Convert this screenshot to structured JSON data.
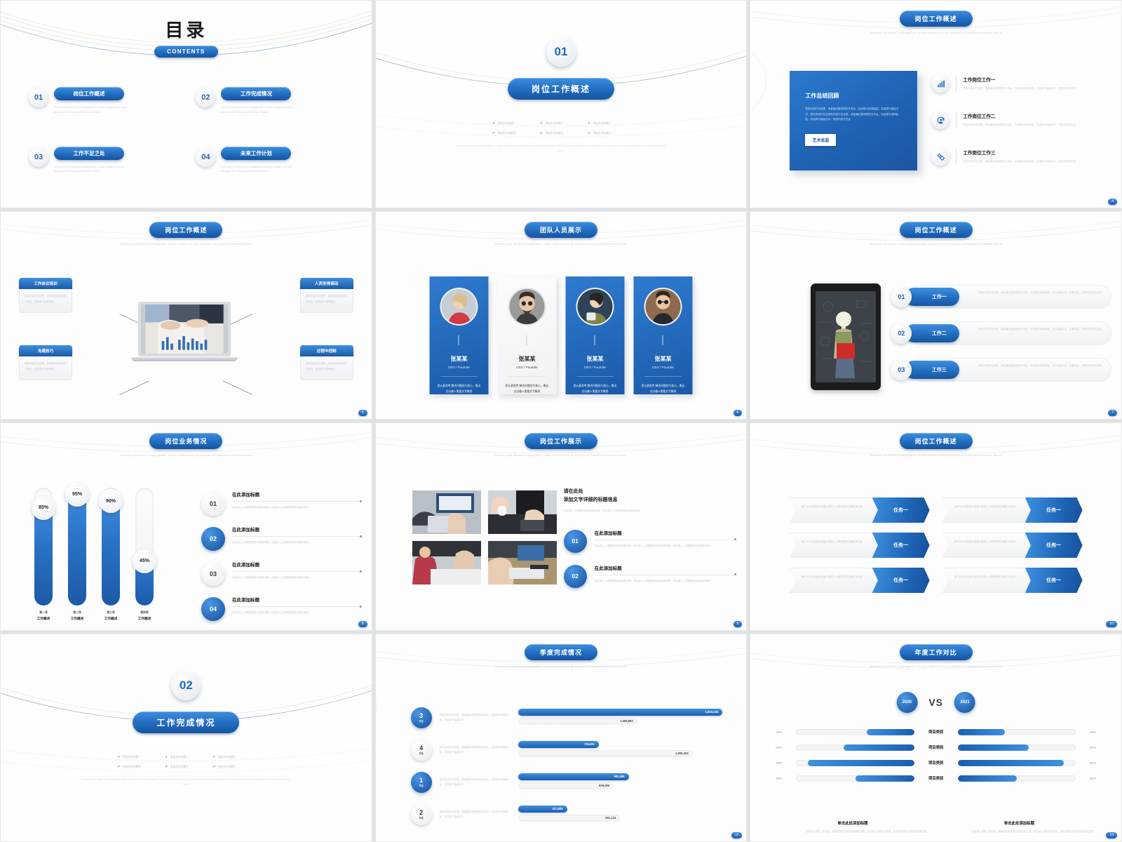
{
  "deck": {
    "theme_accent": "#1f66b8",
    "theme_accent_light": "#3f90e0"
  },
  "slides": [
    {
      "page": "",
      "kind": "contents",
      "title": "目录",
      "contents_label": "CONTENTS",
      "items": [
        {
          "num": "01",
          "label": "岗位工作概述",
          "desc": "Summary and Report of management, simple creative work ppt template of Professional Business Report"
        },
        {
          "num": "02",
          "label": "工作完成情况",
          "desc": "Summary and Report of management, simple creative work ppt template of Professional Business Report"
        },
        {
          "num": "03",
          "label": "工作不足之处",
          "desc": "Summary and Report of management, simple creative work ppt template of Professional Business Report"
        },
        {
          "num": "04",
          "label": "未来工作计划",
          "desc": "Summary and Report of management, simple creative work ppt template of Professional Business Report"
        }
      ]
    },
    {
      "page": "",
      "kind": "section",
      "number": "01",
      "title": "岗位工作概述",
      "checks": [
        "添加文字标题一",
        "添加文字标题二",
        "添加文字标题三",
        "添加文字标题四",
        "添加文字标题五",
        "添加文字标题六"
      ],
      "footer": "Summary and Report of management, simple creative work ppt template of Professional Business Report. Summary and Report of management, simple creative work ppt template of Professional Business Report"
    },
    {
      "page": "4",
      "kind": "card-icons",
      "title": "岗位工作概述",
      "subtitle": "Summary and Report of management, simple creative work ppt template of Professional Business Report",
      "card": {
        "heading": "工作总结回顾",
        "body": "您的内容打在这里，或者通过复制您的文本后，在此框中选择粘贴，并选择只保留文字。您的内容打在这您的内容打在这里，或者通过复制您的文本后，在此框中选择粘贴，并选择只保留文字。您的内容打在这",
        "button": "艺术总监"
      },
      "rows": [
        {
          "icon": "bar-chart-icon",
          "heading": "工作岗位工作一",
          "body": "您的内容打在这里，或者通过复制您的文本后，在此框中选择粘贴，并选择只保留文字。您的内容打在这"
        },
        {
          "icon": "user-cycle-icon",
          "heading": "工作岗位工作二",
          "body": "您的内容打在这里，或者通过复制您的文本后，在此框中选择粘贴，并选择只保留文字。您的内容打在这"
        },
        {
          "icon": "gears-icon",
          "heading": "工作岗位工作三",
          "body": "您的内容打在这里，或者通过复制您的文本后，在此框中选择粘贴，并选择只保留文字。您的内容打在这"
        }
      ]
    },
    {
      "page": "5",
      "kind": "laptop-diagram",
      "title": "岗位工作概述",
      "subtitle": "Summary and Report of management, simple creative work ppt template of Professional Business Report",
      "boxes": [
        {
          "heading": "工作会议培训",
          "body": "您的内容打在这里，或者通过复制您的文本后，在此框中选择粘贴。"
        },
        {
          "heading": "人员安排调动",
          "body": "您的内容打在这里，或者通过复制您的文本后，在此框中选择粘贴。"
        },
        {
          "heading": "沟通技巧",
          "body": "您的内容打在这里，或者通过复制您的文本后，在此框中选择粘贴。"
        },
        {
          "heading": "过程中控制",
          "body": "您的内容打在这里，或者通过复制您的文本后，在此框中选择粘贴。"
        }
      ]
    },
    {
      "page": "6",
      "kind": "team",
      "title": "团队人员展示",
      "subtitle": "Summary and Report of management, simple creative work ppt template of Professional Business Report",
      "members": [
        {
          "name": "张某某",
          "role": "CEO / Founder",
          "bio": "您认真思考 解决问题技巧核心，概念点击输入需要文字解说",
          "style": "dark"
        },
        {
          "name": "张某某",
          "role": "CEO / Founder",
          "bio": "您认真思考 解决问题技巧核心，概念点击输入需要文字解说",
          "style": "light"
        },
        {
          "name": "张某某",
          "role": "CEO / Founder",
          "bio": "您认真思考 解决问题技巧核心，概念点击输入需要文字解说",
          "style": "dark"
        },
        {
          "name": "张某某",
          "role": "CEO / Founder",
          "bio": "您认真思考 解决问题技巧核心，概念点击输入需要文字解说",
          "style": "dark"
        }
      ]
    },
    {
      "page": "7",
      "kind": "tablet-steps",
      "title": "岗位工作概述",
      "subtitle": "Summary and Report of management, simple creative work ppt template of Professional Business Report",
      "steps": [
        {
          "num": "01",
          "label": "工作一",
          "body": "您的内容打在这里，或者通过复制您的文本后，在此框中选择粘贴，并只保留文字。主要内容，您的内容打在这里。"
        },
        {
          "num": "02",
          "label": "工作二",
          "body": "您的内容打在这里，或者通过复制您的文本后，在此框中选择粘贴，并只保留文字。主要内容，您的内容打在这里。"
        },
        {
          "num": "03",
          "label": "工作三",
          "body": "您的内容打在这里，或者通过复制您的文本后，在此框中选择粘贴，并只保留文字。主要内容，您的内容打在这里。"
        }
      ]
    },
    {
      "page": "8",
      "kind": "gauges",
      "title": "岗位业务情况",
      "subtitle": "Summary and Report of management, simple creative work ppt template of Professional Business Report",
      "chart_data": {
        "type": "bar",
        "orientation": "vertical",
        "title": "岗位业务情况",
        "categories": [
          "第一项",
          "第二项",
          "第三项",
          "第四项"
        ],
        "sublabels": [
          "工作概述",
          "工作概述",
          "工作概述",
          "工作概述"
        ],
        "values": [
          85,
          95,
          90,
          45
        ],
        "value_labels": [
          "85%",
          "95%",
          "90%",
          "45%"
        ],
        "ylim": [
          0,
          100
        ],
        "ylabel": "",
        "xlabel": "",
        "grid": false
      },
      "list": [
        {
          "num": "01",
          "heading": "在此添加标题",
          "body": "在此录入上述图表的综合描述说明，在此录入上述图表的综合描述说明。",
          "style": "light"
        },
        {
          "num": "02",
          "heading": "在此添加标题",
          "body": "在此录入上述图表的综合描述说明，在此录入上述图表的综合描述说明。",
          "style": "dark"
        },
        {
          "num": "03",
          "heading": "在此添加标题",
          "body": "在此录入上述图表的综合描述说明，在此录入上述图表的综合描述说明。",
          "style": "light"
        },
        {
          "num": "04",
          "heading": "在此添加标题",
          "body": "在此录入上述图表的综合描述说明，在此录入上述图表的综合描述说明。",
          "style": "dark"
        }
      ]
    },
    {
      "page": "9",
      "kind": "photo-grid",
      "title": "岗位工作展示",
      "subtitle": "Summary and Report of management, simple creative work ppt template of Professional Business Report",
      "headline_1": "请在此处",
      "headline_2": "添加文字详细的标题信息",
      "headline_sub": "在此录入上述图表的综合描述说明，在此录入上述图表的综合描述说明。",
      "items": [
        {
          "num": "01",
          "heading": "在此添加标题",
          "body": "在此录入上述图表的综合描述说明，在此录入上述图表的综合描述说明，在此录入上述图表的综合描述说明。"
        },
        {
          "num": "02",
          "heading": "在此添加标题",
          "body": "在此录入上述图表的综合描述说明，在此录入上述图表的综合描述说明，在此录入上述图表的综合描述说明。"
        }
      ]
    },
    {
      "page": "10",
      "kind": "chevrons",
      "title": "岗位工作概述",
      "subtitle": "Summary and Report of management, simple creative work ppt template of Professional Business Report",
      "items": [
        {
          "body": "用户可以在投影仪或者计算机上以将漂亮的文稿打印出来",
          "label": "任务一"
        },
        {
          "body": "用户可以在投影仪或者计算机上以将漂亮的文稿打印出来",
          "label": "任务一"
        },
        {
          "body": "用户可以在投影仪或者计算机上以将漂亮的文稿打印出来",
          "label": "任务一"
        },
        {
          "body": "用户可以在投影仪或者计算机上以将漂亮的文稿打印出来",
          "label": "任务一"
        },
        {
          "body": "用户可以在投影仪或者计算机上以将漂亮的文稿打印出来",
          "label": "任务一"
        },
        {
          "body": "用户可以在投影仪或者计算机上以将漂亮的文稿打印出来",
          "label": "任务一"
        }
      ]
    },
    {
      "page": "11",
      "kind": "section",
      "number": "02",
      "title": "工作完成情况",
      "checks": [
        "添加文字标题一",
        "添加文字标题二",
        "添加文字标题三",
        "添加文字标题四",
        "添加文字标题五",
        "添加文字标题六"
      ],
      "footer": "Summary and Report of management, simple creative work ppt template of Professional Business Report. Summary and Report of management, simple creative work ppt template of Professional Business Report"
    },
    {
      "page": "12",
      "kind": "quarter-bars",
      "title": "季度完成情况",
      "subtitle": "Summary and Report of management, simple creative work ppt template of Professional Business Report",
      "chart_data": {
        "type": "bar",
        "orientation": "horizontal",
        "title": "季度完成情况",
        "categories": [
          "3 季度",
          "4 季度",
          "1 季度",
          "2 季度"
        ],
        "series": [
          {
            "name": "主值",
            "values": [
              1823445,
              725091,
              981406,
              427683
            ]
          },
          {
            "name": "对比值",
            "values": [
              1058883,
              1550334,
              846356,
              901124
            ]
          }
        ],
        "value_labels": {
          "主值": [
            "1,823,445",
            "725,091",
            "981,406",
            "427,683"
          ],
          "对比值": [
            "1,058,883",
            "1,550,334",
            "846,356",
            "901,124"
          ]
        },
        "xlim": [
          0,
          1900000
        ],
        "grid": false
      },
      "rows": [
        {
          "num": "3",
          "unit": "季度",
          "style": "dark",
          "desc": "您的内容打在这里，或者通过复制您的文本后，在此框中选择粘贴，并选择只保留文字。",
          "main": "1,823,445",
          "main_pct": 96,
          "alt": "1,058,883",
          "alt_pct": 56
        },
        {
          "num": "4",
          "unit": "季度",
          "style": "light",
          "desc": "您的内容打在这里，或者通过复制您的文本后，在此框中选择粘贴，并选择只保留文字。",
          "main": "725,091",
          "main_pct": 38,
          "alt": "1,550,334",
          "alt_pct": 82
        },
        {
          "num": "1",
          "unit": "季度",
          "style": "dark",
          "desc": "您的内容打在这里，或者通过复制您的文本后，在此框中选择粘贴，并选择只保留文字。",
          "main": "981,406",
          "main_pct": 52,
          "alt": "846,356",
          "alt_pct": 45
        },
        {
          "num": "2",
          "unit": "季度",
          "style": "light",
          "desc": "您的内容打在这里，或者通过复制您的文本后，在此框中选择粘贴，并选择只保留文字。",
          "main": "427,683",
          "main_pct": 23,
          "alt": "901,124",
          "alt_pct": 48
        }
      ]
    },
    {
      "page": "13",
      "kind": "vs-compare",
      "title": "年度工作对比",
      "subtitle": "Summary and Report of management, simple creative work ppt template of Professional Business Report",
      "left_year": "2020",
      "right_year": "2021",
      "vs_label": "VS",
      "chart_data": {
        "type": "bar",
        "orientation": "horizontal-diverging",
        "title": "年度工作对比",
        "categories": [
          "项目类别",
          "项目类别",
          "项目类别",
          "项目类别"
        ],
        "series": [
          {
            "name": "2020",
            "values": [
              40,
              60,
              90,
              50
            ]
          },
          {
            "name": "2021",
            "values": [
              40,
              60,
              90,
              50
            ]
          }
        ],
        "tick_labels": [
          "40%",
          "60%",
          "90%",
          "50%"
        ],
        "xlim": [
          0,
          100
        ],
        "grid": false
      },
      "rows": [
        {
          "left_pct": "40%",
          "left_val": 40,
          "cat": "项目类别",
          "right_pct": "40%",
          "right_val": 40
        },
        {
          "left_pct": "60%",
          "left_val": 60,
          "cat": "项目类别",
          "right_pct": "60%",
          "right_val": 60
        },
        {
          "left_pct": "90%",
          "left_val": 90,
          "cat": "项目类别",
          "right_pct": "90%",
          "right_val": 90
        },
        {
          "left_pct": "50%",
          "left_val": 50,
          "cat": "项目类别",
          "right_pct": "50%",
          "right_val": 50
        }
      ],
      "footers": [
        {
          "heading": "单击此处添加标题",
          "body": "在此录入您的工作内容，或者将您的文字内容复制在这里，在此录入您的文字内容，也可将您的文字内容复制在这里"
        },
        {
          "heading": "单击此处添加标题",
          "body": "在此录入您的工作内容，或者将您的文字内容复制在这里，在此录入您的文字内容，也可将您的文字内容复制在这里"
        }
      ]
    }
  ]
}
